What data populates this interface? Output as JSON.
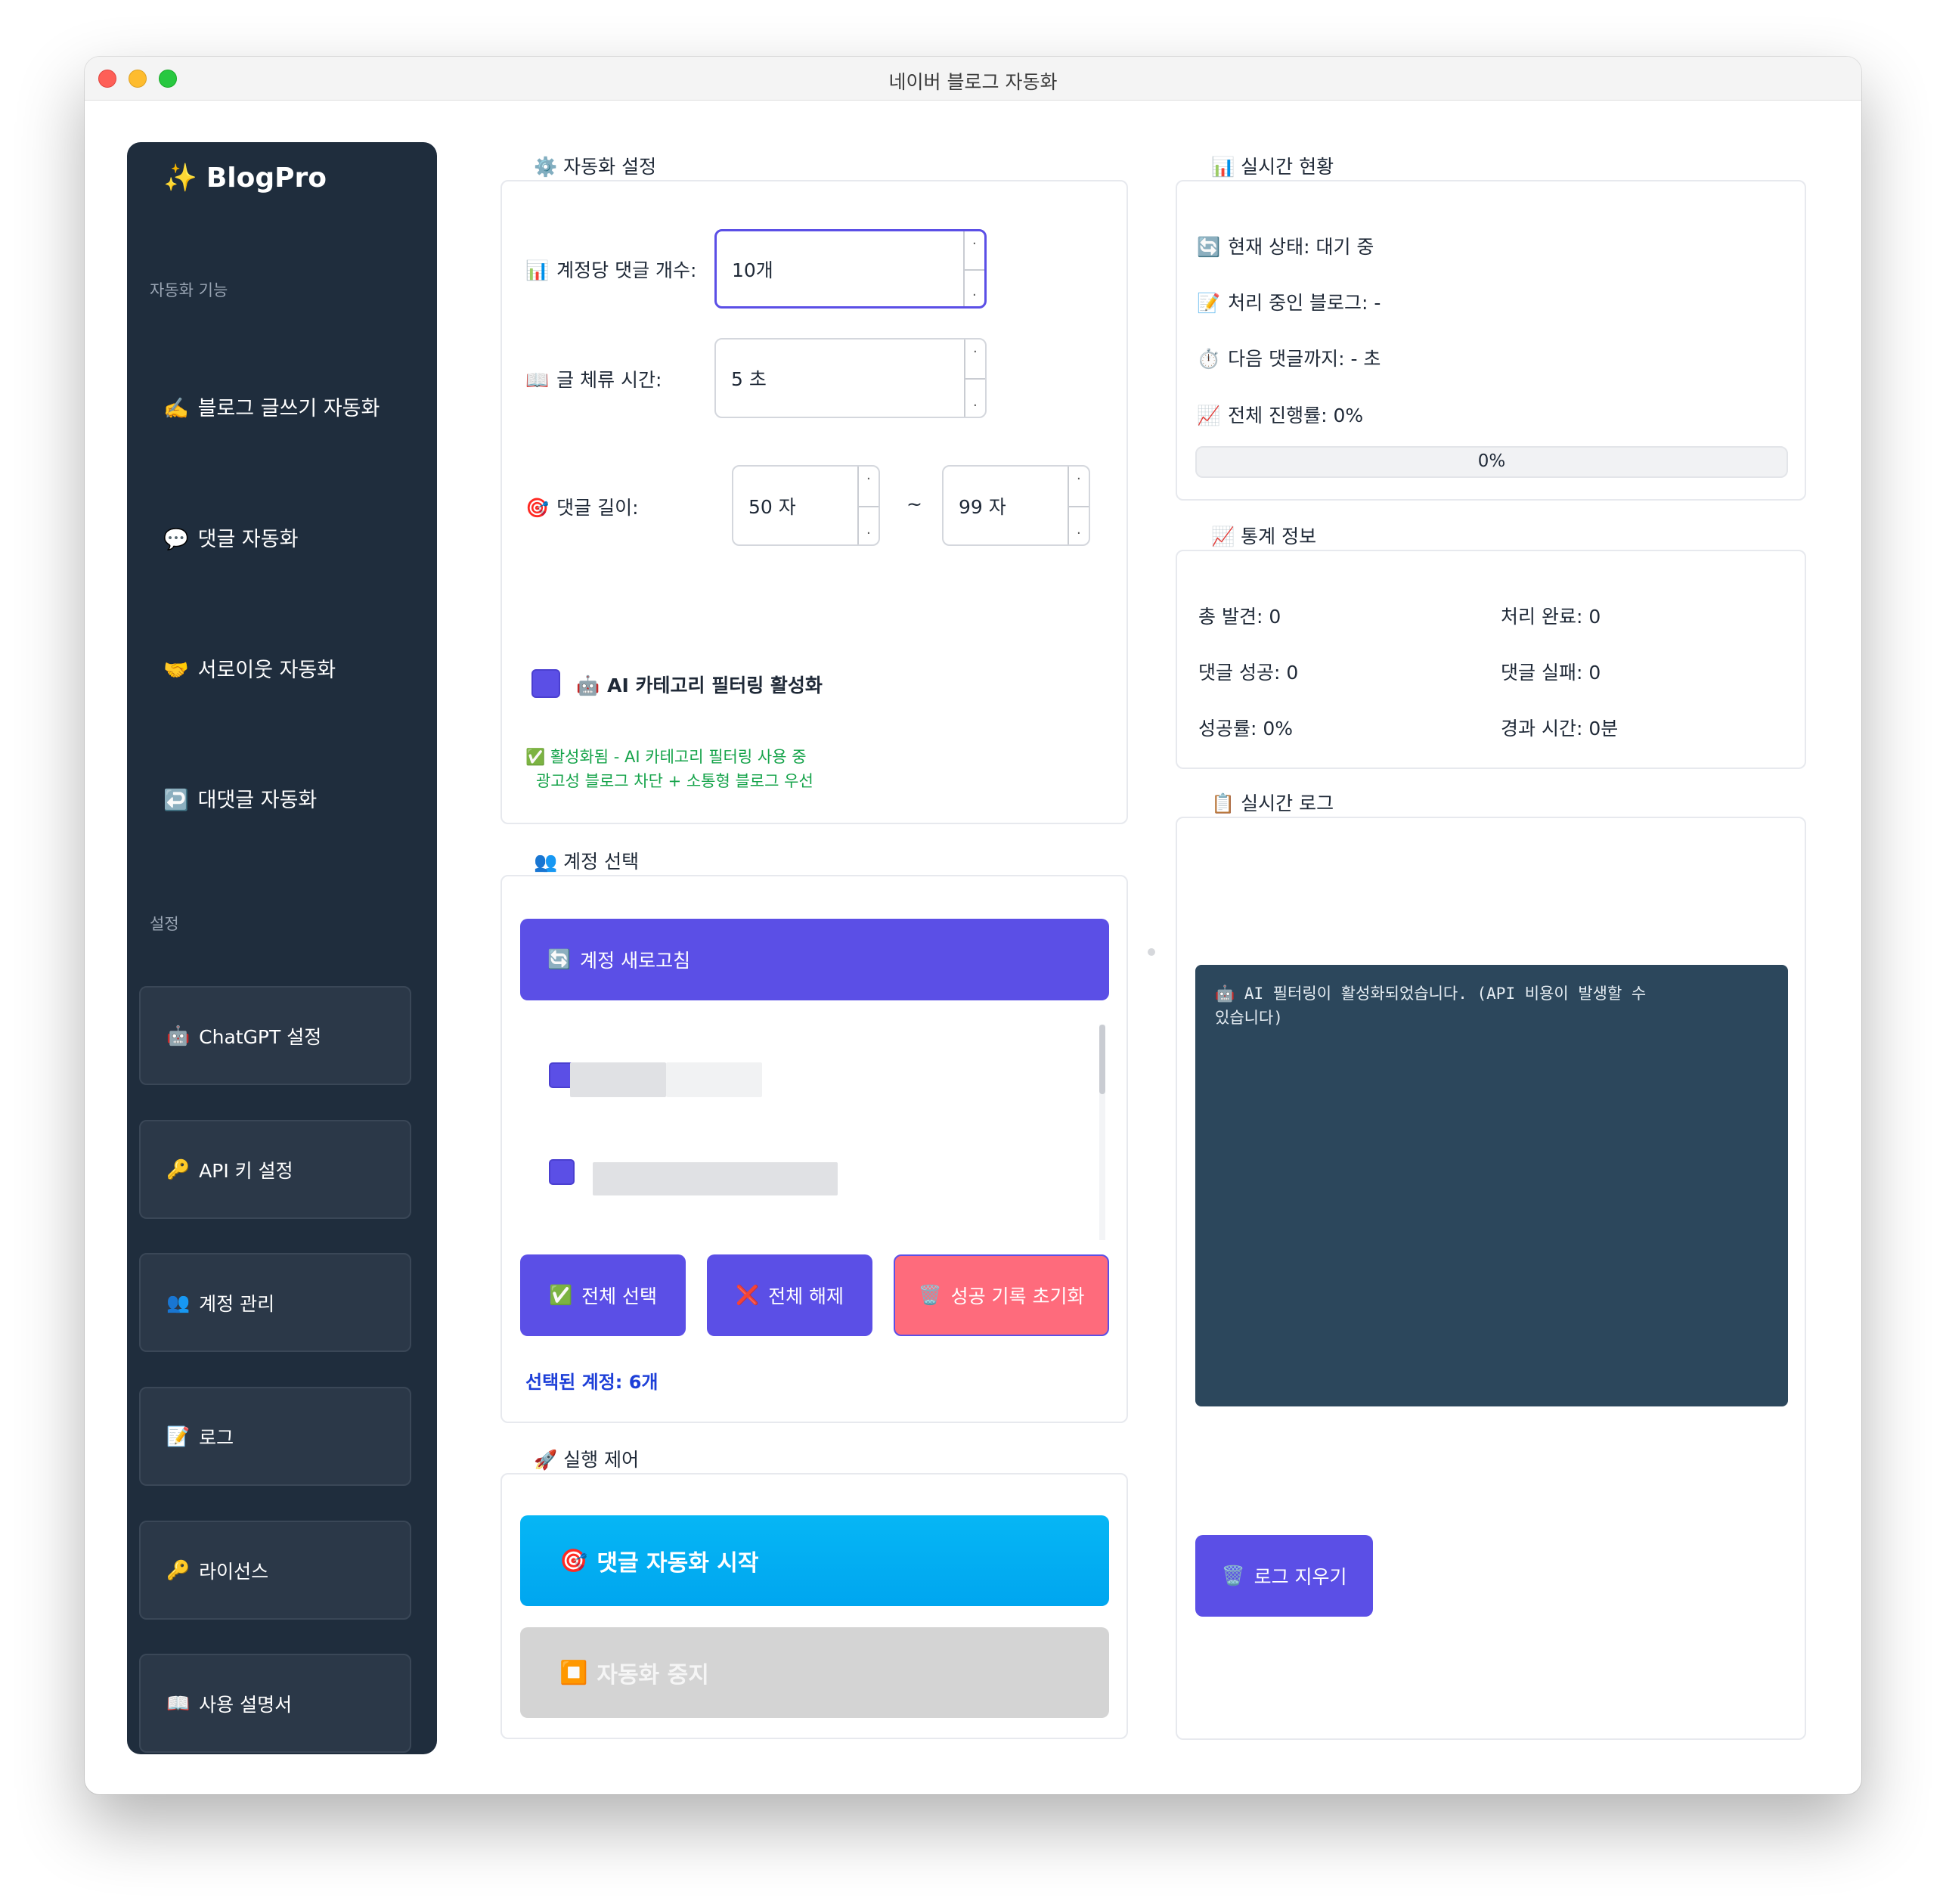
{
  "window": {
    "title": "네이버 블로그 자동화"
  },
  "sidebar": {
    "brand_icon": "✨",
    "brand": "BlogPro",
    "section_features": "자동화 기능",
    "features": [
      {
        "icon": "✍️",
        "label": "블로그 글쓰기 자동화"
      },
      {
        "icon": "💬",
        "label": "댓글 자동화"
      },
      {
        "icon": "🤝",
        "label": "서로이웃 자동화"
      },
      {
        "icon": "↩️",
        "label": "대댓글 자동화"
      }
    ],
    "section_settings": "설정",
    "settings": [
      {
        "icon": "🤖",
        "label": "ChatGPT 설정"
      },
      {
        "icon": "🔑",
        "label": "API 키 설정"
      },
      {
        "icon": "👥",
        "label": "계정 관리"
      },
      {
        "icon": "📝",
        "label": "로그"
      },
      {
        "icon": "🔑",
        "label": "라이선스"
      },
      {
        "icon": "📖",
        "label": "사용 설명서"
      }
    ]
  },
  "automation": {
    "title_icon": "⚙️",
    "title": "자동화 설정",
    "comments_per_account": {
      "icon": "📊",
      "label": "계정당 댓글 개수:",
      "value": "10개"
    },
    "stay_time": {
      "icon": "📖",
      "label": "글 체류 시간:",
      "value": "5 초"
    },
    "comment_length": {
      "icon": "🎯",
      "label": "댓글 길이:",
      "min": "50 자",
      "separator": "~",
      "max": "99 자"
    },
    "ai_filter": {
      "icon": "🤖",
      "label": "AI 카테고리 필터링 활성화",
      "checked": true
    },
    "ai_note_icon": "✅",
    "ai_note_line1": "활성화됨 - AI 카테고리 필터링 사용 중",
    "ai_note_line2": "광고성 블로그 차단 + 소통형 블로그 우선"
  },
  "accounts": {
    "title_icon": "👥",
    "title": "계정 선택",
    "refresh_icon": "🔄",
    "refresh": "계정 새로고침",
    "select_all_icon": "✅",
    "select_all": "전체 선택",
    "deselect_all_icon": "❌",
    "deselect_all": "전체 해제",
    "reset_icon": "🗑️",
    "reset": "성공 기록 초기화",
    "selected": "선택된 계정: 6개"
  },
  "control": {
    "title_icon": "🚀",
    "title": "실행 제어",
    "start_icon": "🎯",
    "start": "댓글 자동화 시작",
    "stop_icon": "⏹️",
    "stop": "자동화 중지"
  },
  "status": {
    "title_icon": "📊",
    "title": "실시간 현황",
    "lines": [
      {
        "icon": "🔄",
        "text": "현재 상태: 대기 중"
      },
      {
        "icon": "📝",
        "text": "처리 중인 블로그: -"
      },
      {
        "icon": "⏱️",
        "text": "다음 댓글까지: - 초"
      },
      {
        "icon": "📈",
        "text": "전체 진행률: 0%"
      }
    ],
    "progress": 0,
    "progress_label": "0%"
  },
  "stats": {
    "title_icon": "📈",
    "title": "통계 정보",
    "total_found": "총 발견: 0",
    "processed": "처리 완료: 0",
    "comment_success": "댓글 성공: 0",
    "comment_fail": "댓글 실패: 0",
    "success_rate": "성공률: 0%",
    "elapsed": "경과 시간: 0분"
  },
  "log": {
    "title_icon": "📋",
    "title": "실시간 로그",
    "line_icon": "🤖",
    "line1": "AI 필터링이 활성화되었습니다. (API 비용이 발생할 수",
    "line2": "있습니다)",
    "clear_icon": "🗑️",
    "clear": "로그 지우기"
  },
  "colors": {
    "accent": "#5b4fe6",
    "sidebar": "#1f2d3d",
    "start": "#00a6ef",
    "reset": "#fe6b7c",
    "log_bg": "#2c475c"
  }
}
